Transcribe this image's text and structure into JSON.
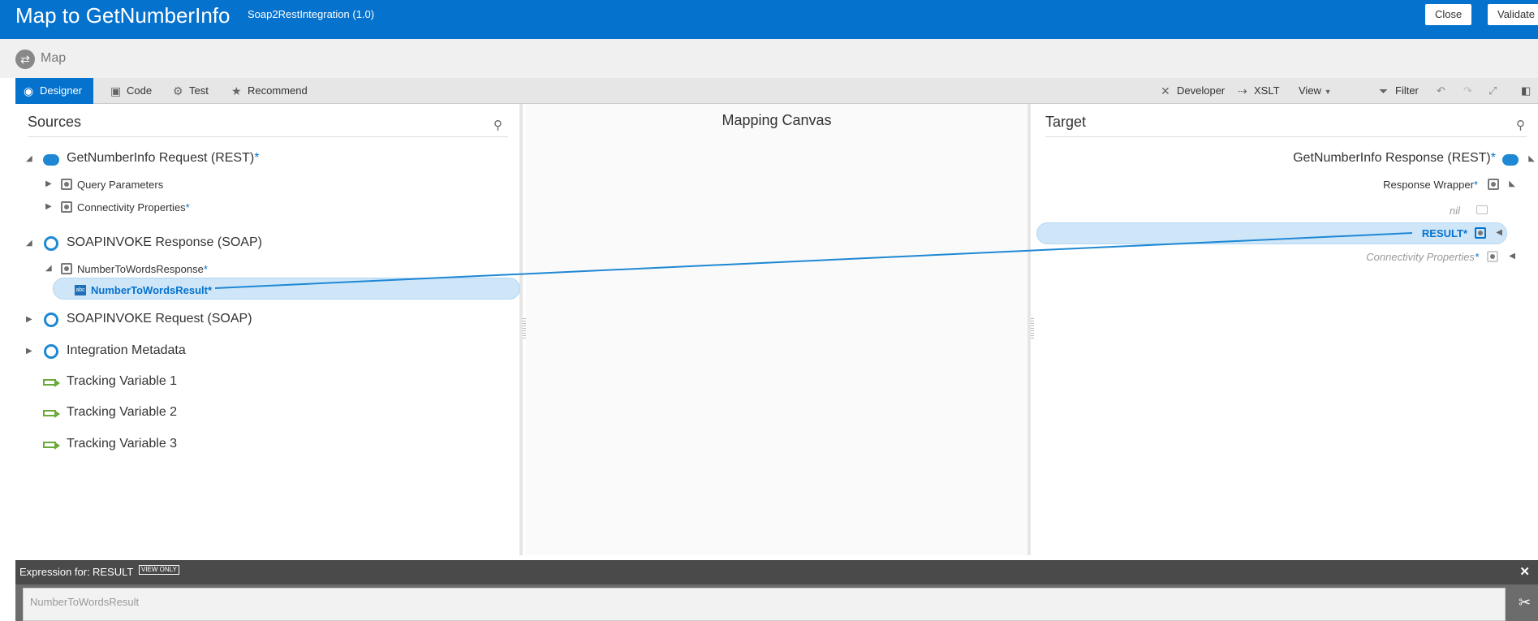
{
  "header": {
    "title": "Map to GetNumberInfo",
    "subtitle": "Soap2RestIntegration (1.0)",
    "close_label": "Close",
    "validate_label": "Validate"
  },
  "mapbar": {
    "label": "Map"
  },
  "toolbar": {
    "tabs": [
      {
        "label": "Designer",
        "icon": "designer-icon",
        "active": true
      },
      {
        "label": "Code",
        "icon": "code-icon"
      },
      {
        "label": "Test",
        "icon": "gear-icon"
      },
      {
        "label": "Recommend",
        "icon": "star-icon"
      }
    ],
    "right": [
      {
        "label": "Developer",
        "icon": "wrench-icon"
      },
      {
        "label": "XSLT",
        "icon": "xslt-icon"
      },
      {
        "label": "View",
        "icon": "chevron-down-icon"
      },
      {
        "label": "Filter",
        "icon": "filter-icon"
      }
    ]
  },
  "sources": {
    "title": "Sources",
    "nodes": [
      {
        "label": "GetNumberInfo Request (REST)",
        "required": "*"
      },
      {
        "label": "Query Parameters"
      },
      {
        "label": "Connectivity Properties",
        "required": "*"
      },
      {
        "label": "SOAPINVOKE Response (SOAP)"
      },
      {
        "label": "NumberToWordsResponse",
        "required": "*"
      },
      {
        "label": "NumberToWordsResult",
        "required": "*"
      },
      {
        "label": "SOAPINVOKE Request (SOAP)"
      },
      {
        "label": "Integration Metadata"
      },
      {
        "label": "Tracking Variable 1"
      },
      {
        "label": "Tracking Variable 2"
      },
      {
        "label": "Tracking Variable 3"
      }
    ]
  },
  "canvas": {
    "title": "Mapping Canvas"
  },
  "target": {
    "title": "Target",
    "nodes": [
      {
        "label": "GetNumberInfo Response (REST)",
        "required": "*"
      },
      {
        "label": "Response Wrapper",
        "required": "*"
      },
      {
        "label": "nil"
      },
      {
        "label": "RESULT",
        "required": "*"
      },
      {
        "label": "Connectivity Properties",
        "required": "*"
      }
    ]
  },
  "expression": {
    "label": "Expression for:",
    "target": "RESULT",
    "badge": "VIEW ONLY",
    "value": "NumberToWordsResult"
  },
  "colors": {
    "brand": "#0572ce",
    "link": "#1e88d4",
    "track": "#6aaa3a"
  }
}
